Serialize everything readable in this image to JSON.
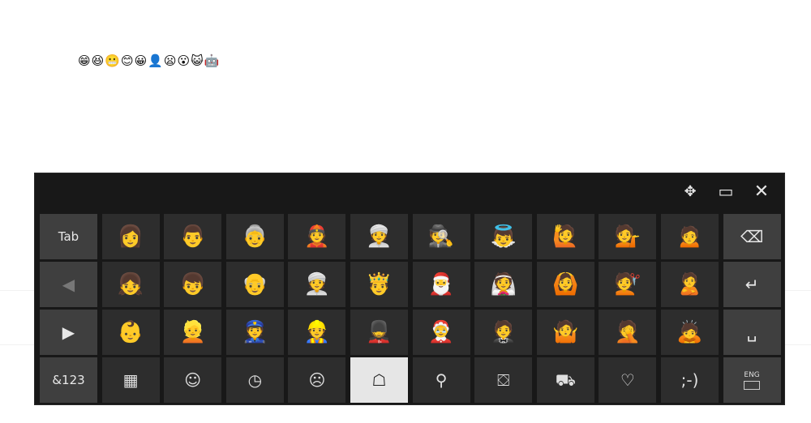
{
  "document": {
    "typed_text": "😁😆😬😊😀👤😦😮😺🤖"
  },
  "keyboard": {
    "titlebar": {
      "dock_icon": "✥",
      "layout_icon": "▭",
      "close_icon": "✕"
    },
    "rows": [
      [
        {
          "type": "func",
          "label": "Tab",
          "name": "tab-key"
        },
        {
          "type": "emoji",
          "label": "👩",
          "name": "emoji-woman"
        },
        {
          "type": "emoji",
          "label": "👨",
          "name": "emoji-man"
        },
        {
          "type": "emoji",
          "label": "👵",
          "name": "emoji-older-woman"
        },
        {
          "type": "emoji",
          "label": "👲",
          "name": "emoji-man-with-cap"
        },
        {
          "type": "emoji",
          "label": "👳",
          "name": "emoji-person-turban"
        },
        {
          "type": "emoji",
          "label": "🕵",
          "name": "emoji-detective"
        },
        {
          "type": "emoji",
          "label": "👼",
          "name": "emoji-angel"
        },
        {
          "type": "emoji",
          "label": "🙋",
          "name": "emoji-raising-hand"
        },
        {
          "type": "emoji",
          "label": "💁",
          "name": "emoji-tipping-hand"
        },
        {
          "type": "emoji",
          "label": "🙍",
          "name": "emoji-frowning"
        },
        {
          "type": "func",
          "label": "⌫",
          "name": "backspace-key"
        }
      ],
      [
        {
          "type": "func",
          "label": "◀",
          "name": "prev-page-key",
          "disabled": true
        },
        {
          "type": "emoji",
          "label": "👧",
          "name": "emoji-girl"
        },
        {
          "type": "emoji",
          "label": "👦",
          "name": "emoji-boy"
        },
        {
          "type": "emoji",
          "label": "👴",
          "name": "emoji-older-man"
        },
        {
          "type": "emoji",
          "label": "👳",
          "name": "emoji-turban-man"
        },
        {
          "type": "emoji",
          "label": "🤴",
          "name": "emoji-prince"
        },
        {
          "type": "emoji",
          "label": "🎅",
          "name": "emoji-santa"
        },
        {
          "type": "emoji",
          "label": "👰",
          "name": "emoji-bride"
        },
        {
          "type": "emoji",
          "label": "🙆",
          "name": "emoji-ok-gesture"
        },
        {
          "type": "emoji",
          "label": "💇",
          "name": "emoji-haircut"
        },
        {
          "type": "emoji",
          "label": "🙎",
          "name": "emoji-pouting"
        },
        {
          "type": "func",
          "label": "↵",
          "name": "enter-key"
        }
      ],
      [
        {
          "type": "func",
          "label": "▶",
          "name": "next-page-key"
        },
        {
          "type": "emoji",
          "label": "👶",
          "name": "emoji-baby"
        },
        {
          "type": "emoji",
          "label": "👱",
          "name": "emoji-blond"
        },
        {
          "type": "emoji",
          "label": "👮",
          "name": "emoji-police"
        },
        {
          "type": "emoji",
          "label": "👷",
          "name": "emoji-construction"
        },
        {
          "type": "emoji",
          "label": "💂",
          "name": "emoji-guard"
        },
        {
          "type": "emoji",
          "label": "🤶",
          "name": "emoji-mrs-claus"
        },
        {
          "type": "emoji",
          "label": "🤵",
          "name": "emoji-tuxedo"
        },
        {
          "type": "emoji",
          "label": "🤷",
          "name": "emoji-shrug"
        },
        {
          "type": "emoji",
          "label": "🤦",
          "name": "emoji-facepalm"
        },
        {
          "type": "emoji",
          "label": "🙇",
          "name": "emoji-bowing"
        },
        {
          "type": "func",
          "label": "␣",
          "name": "space-key"
        }
      ],
      [
        {
          "type": "func",
          "label": "&123",
          "name": "symbols-key"
        },
        {
          "type": "cat",
          "label": "▦",
          "name": "category-recent"
        },
        {
          "type": "cat",
          "label": "☺",
          "name": "category-smileys"
        },
        {
          "type": "cat",
          "label": "◷",
          "name": "category-time"
        },
        {
          "type": "cat",
          "label": "☹",
          "name": "category-faces"
        },
        {
          "type": "cat",
          "label": "☖",
          "name": "category-people",
          "selected": true
        },
        {
          "type": "cat",
          "label": "⚲",
          "name": "category-nature"
        },
        {
          "type": "cat",
          "label": "⛋",
          "name": "category-food"
        },
        {
          "type": "cat",
          "label": "⛟",
          "name": "category-travel"
        },
        {
          "type": "cat",
          "label": "♡",
          "name": "category-symbols"
        },
        {
          "type": "cat",
          "label": ";-)",
          "name": "category-emoticons"
        },
        {
          "type": "lang",
          "label": "ENG",
          "name": "language-key"
        }
      ]
    ]
  }
}
